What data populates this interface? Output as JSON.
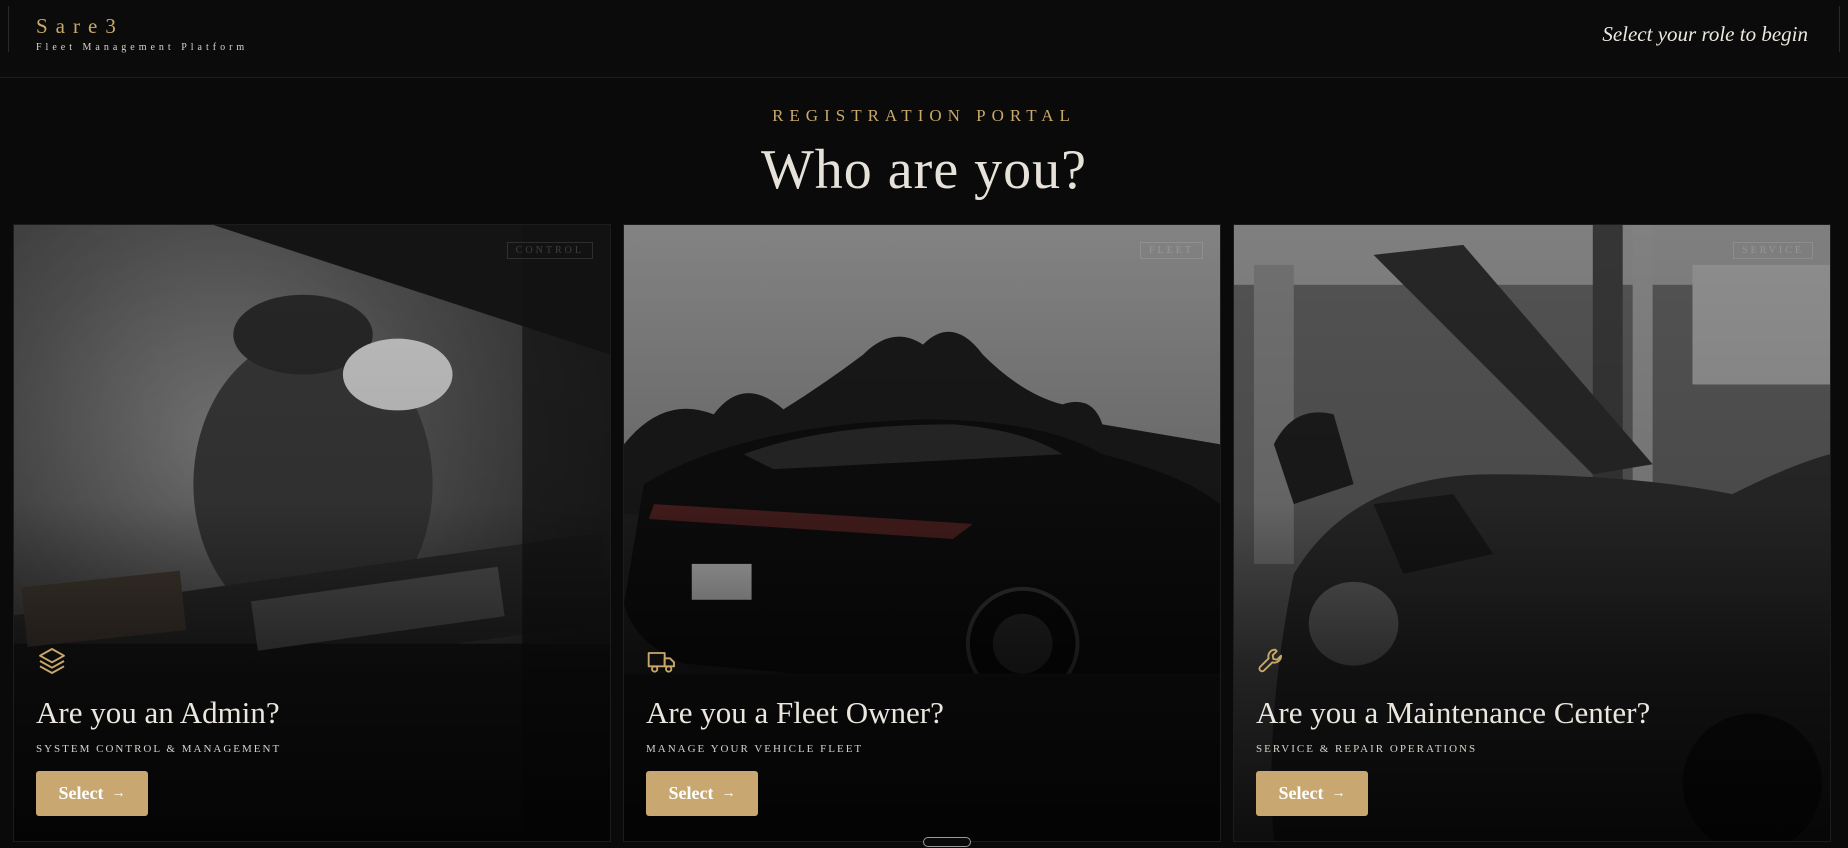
{
  "header": {
    "brand": "Sare3",
    "brand_subtitle": "Fleet Management Platform",
    "hint": "Select your role to begin"
  },
  "hero": {
    "eyebrow": "REGISTRATION PORTAL",
    "title": "Who are you?"
  },
  "cards": [
    {
      "tag": "CONTROL",
      "icon": "layers-icon",
      "title": "Are you an Admin?",
      "subtitle": "SYSTEM CONTROL & MANAGEMENT",
      "button": "Select",
      "button_icon": "arrow-right-icon"
    },
    {
      "tag": "FLEET",
      "icon": "truck-icon",
      "title": "Are you a Fleet Owner?",
      "subtitle": "MANAGE YOUR VEHICLE FLEET",
      "button": "Select",
      "button_icon": "arrow-right-icon"
    },
    {
      "tag": "SERVICE",
      "icon": "wrench-icon",
      "title": "Are you a Maintenance Center?",
      "subtitle": "SERVICE & REPAIR OPERATIONS",
      "button": "Select",
      "button_icon": "arrow-right-icon"
    }
  ],
  "colors": {
    "accent_gold": "#c9a86a",
    "button_gold": "#c8a870",
    "background": "#0a0a0a",
    "text": "#e8e4dc"
  }
}
